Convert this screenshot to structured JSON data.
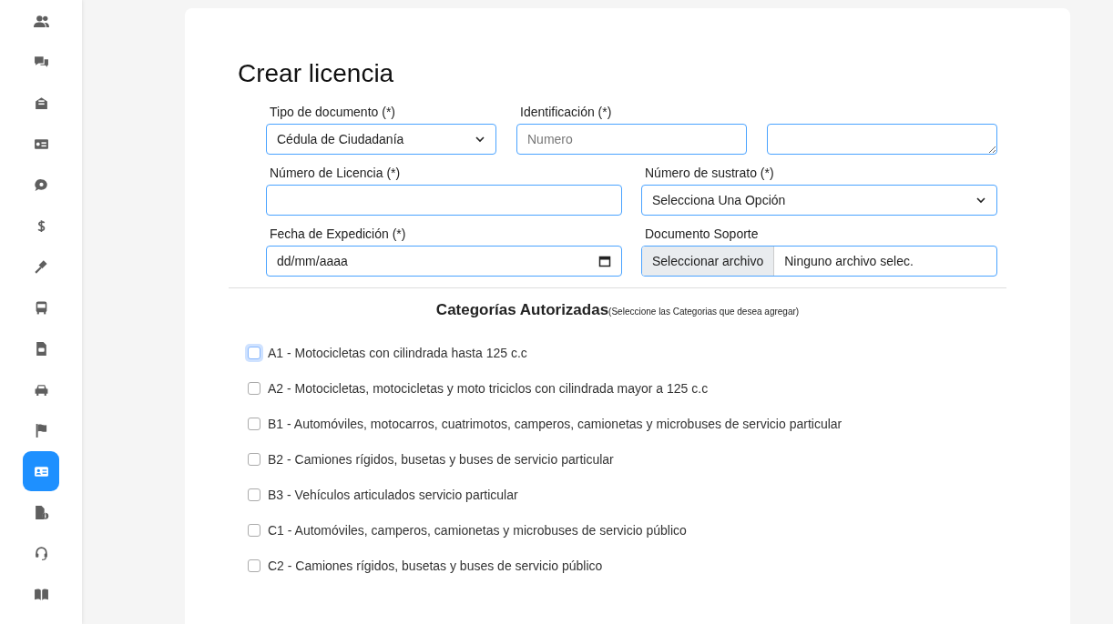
{
  "sidebar": {
    "items": [
      {
        "selected": false
      },
      {
        "selected": false
      },
      {
        "selected": false
      },
      {
        "selected": false
      },
      {
        "selected": false
      },
      {
        "selected": false
      },
      {
        "selected": false
      },
      {
        "selected": false
      },
      {
        "selected": false
      },
      {
        "selected": false
      },
      {
        "selected": false
      },
      {
        "selected": true
      },
      {
        "selected": false
      },
      {
        "selected": false
      },
      {
        "selected": false
      }
    ]
  },
  "form": {
    "title": "Crear licencia",
    "row_1": [
      {
        "kind": "select",
        "label": "Tipo de documento (*)",
        "value": "Cédula de Ciudadanía"
      },
      {
        "kind": "input",
        "label": "Identificación (*)",
        "placeholder": "Numero"
      },
      {
        "kind": "textarea"
      }
    ],
    "row_2": [
      {
        "kind": "input",
        "label": "Número de Licencia (*)"
      },
      {
        "kind": "select",
        "label": "Número de sustrato (*)",
        "value": "Selecciona Una Opción"
      }
    ],
    "row_3": [
      {
        "kind": "date",
        "label": "Fecha de Expedición (*)",
        "value": "dd/mm/aaaa"
      },
      {
        "kind": "file",
        "label": "Documento Soporte",
        "button": "Seleccionar archivo",
        "value": "Ninguno archivo selec."
      }
    ],
    "categories": {
      "heading": "Categorías Autorizadas",
      "hint": "(Seleccione las Categorias que desea agregar)",
      "items": [
        {
          "label": "A1 - Motocicletas con cilindrada hasta 125 c.c",
          "checked": false,
          "focused": true
        },
        {
          "label": "A2 - Motocicletas, motocicletas y moto triciclos con cilindrada mayor a 125 c.c",
          "checked": false,
          "focused": false
        },
        {
          "label": "B1 - Automóviles, motocarros, cuatrimotos, camperos, camionetas y microbuses de servicio particular",
          "checked": false,
          "focused": false
        },
        {
          "label": "B2 - Camiones rígidos, busetas y buses de servicio particular",
          "checked": false,
          "focused": false
        },
        {
          "label": "B3 - Vehículos articulados servicio particular",
          "checked": false,
          "focused": false
        },
        {
          "label": "C1 - Automóviles, camperos, camionetas y microbuses de servicio público",
          "checked": false,
          "focused": false
        },
        {
          "label": "C2 - Camiones rígidos, busetas y buses de servicio público",
          "checked": false,
          "focused": false
        }
      ]
    }
  }
}
